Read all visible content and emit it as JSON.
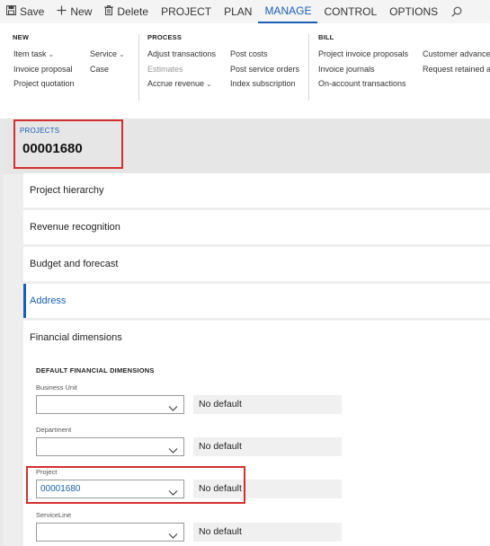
{
  "toolbar": {
    "save": "Save",
    "new": "New",
    "delete": "Delete",
    "tabs": [
      "PROJECT",
      "PLAN",
      "MANAGE",
      "CONTROL",
      "OPTIONS"
    ]
  },
  "ribbon": {
    "new": {
      "title": "NEW",
      "items": [
        "Item task",
        "Invoice proposal",
        "Project quotation",
        "Service",
        "Case"
      ]
    },
    "process": {
      "title": "PROCESS",
      "items": [
        "Adjust transactions",
        "Estimates",
        "Accrue revenue",
        "Post costs",
        "Post service orders",
        "Index subscription"
      ]
    },
    "bill": {
      "title": "BILL",
      "items": [
        "Project invoice proposals",
        "Invoice journals",
        "On-account transactions",
        "Customer advance",
        "Request retained a"
      ]
    }
  },
  "header": {
    "breadcrumb": "PROJECTS",
    "record_id": "00001680"
  },
  "fasttabs": [
    "Project hierarchy",
    "Revenue recognition",
    "Budget and forecast",
    "Address",
    "Financial dimensions"
  ],
  "financial": {
    "section_title": "DEFAULT FINANCIAL DIMENSIONS",
    "fields": [
      {
        "label": "Business Unit",
        "value": "",
        "default": "No default"
      },
      {
        "label": "Department",
        "value": "",
        "default": "No default"
      },
      {
        "label": "Project",
        "value": "00001680",
        "default": "No default"
      },
      {
        "label": "ServiceLine",
        "value": "",
        "default": "No default"
      }
    ]
  },
  "icons": {
    "save": "save-icon",
    "new": "plus-icon",
    "delete": "trash-icon",
    "search": "search-icon",
    "dropdown": "chevron-down-icon"
  },
  "colors": {
    "accent": "#1a5fb4",
    "highlight": "#d32f2f"
  }
}
